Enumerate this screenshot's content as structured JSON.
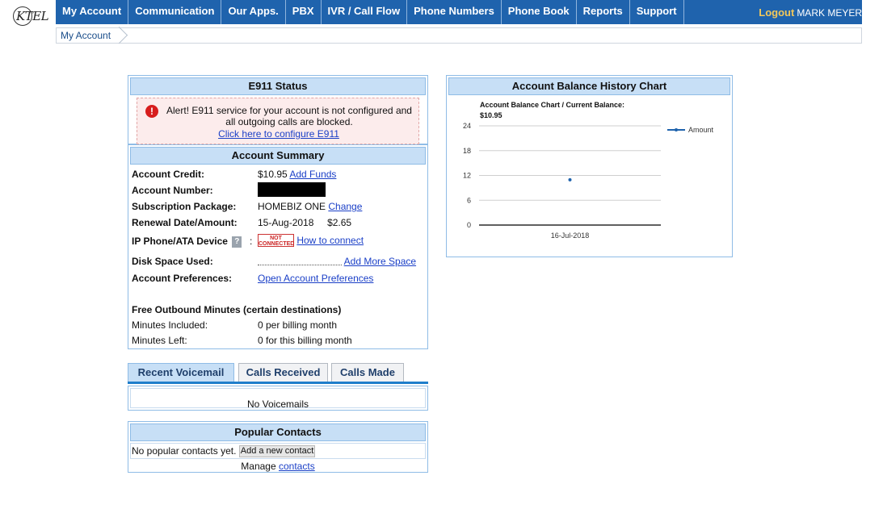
{
  "logo": {
    "text": "KTEL"
  },
  "nav": {
    "items": [
      "My Account",
      "Communication",
      "Our Apps.",
      "PBX",
      "IVR / Call Flow",
      "Phone Numbers",
      "Phone Book",
      "Reports",
      "Support"
    ],
    "logout": "Logout",
    "user": "MARK MEYER"
  },
  "breadcrumb": {
    "current": "My Account"
  },
  "e911": {
    "title": "E911 Status",
    "alert_icon": "!",
    "alert_text": "Alert! E911 service for your account is not configured and all outgoing calls are blocked.",
    "link": "Click here to configure E911"
  },
  "summary": {
    "title": "Account Summary",
    "credit_label": "Account Credit:",
    "credit_value": "$10.95",
    "credit_link": "Add Funds",
    "number_label": "Account Number:",
    "package_label": "Subscription Package:",
    "package_value": "HOMEBIZ ONE",
    "package_link": "Change",
    "renewal_label": "Renewal Date/Amount:",
    "renewal_date": "15-Aug-2018",
    "renewal_amount": "$2.65",
    "device_label": "IP Phone/ATA Device",
    "device_help": "?",
    "device_colon": ":",
    "device_badge_line1": "NOT",
    "device_badge_line2": "CONNECTED",
    "device_link": "How to connect",
    "disk_label": "Disk Space Used:",
    "disk_link": "Add More Space",
    "prefs_label": "Account Preferences:",
    "prefs_link": "Open Account Preferences",
    "free_heading": "Free Outbound Minutes (certain destinations)",
    "included_label": "Minutes Included:",
    "included_value": "0 per billing month",
    "left_label": "Minutes Left:",
    "left_value": "0 for this billing month"
  },
  "tabs": {
    "items": [
      "Recent Voicemail",
      "Calls Received",
      "Calls Made"
    ],
    "active": "Recent Voicemail",
    "empty_text": "No Voicemails"
  },
  "contacts": {
    "title": "Popular Contacts",
    "empty_text": "No popular contacts yet.",
    "add_button": "Add a new contact",
    "manage_text": "Manage",
    "manage_link": "contacts"
  },
  "chart_panel": {
    "title": "Account Balance History Chart"
  },
  "chart_data": {
    "type": "line",
    "title": "Account Balance Chart / Current Balance:",
    "subtitle": "$10.95",
    "x": [
      "16-Jul-2018"
    ],
    "series": [
      {
        "name": "Amount",
        "values": [
          10.95
        ]
      }
    ],
    "ylim": [
      0,
      24
    ],
    "yticks": [
      0,
      6,
      12,
      18,
      24
    ],
    "grid": true,
    "legend": "right",
    "color": "#1f63ad"
  },
  "colors": {
    "nav_bg": "#1f63ad",
    "logout": "#f3c85a",
    "panel_header": "#c7dff6",
    "alert_bg": "#fcecec",
    "link": "#1a3fc7"
  }
}
